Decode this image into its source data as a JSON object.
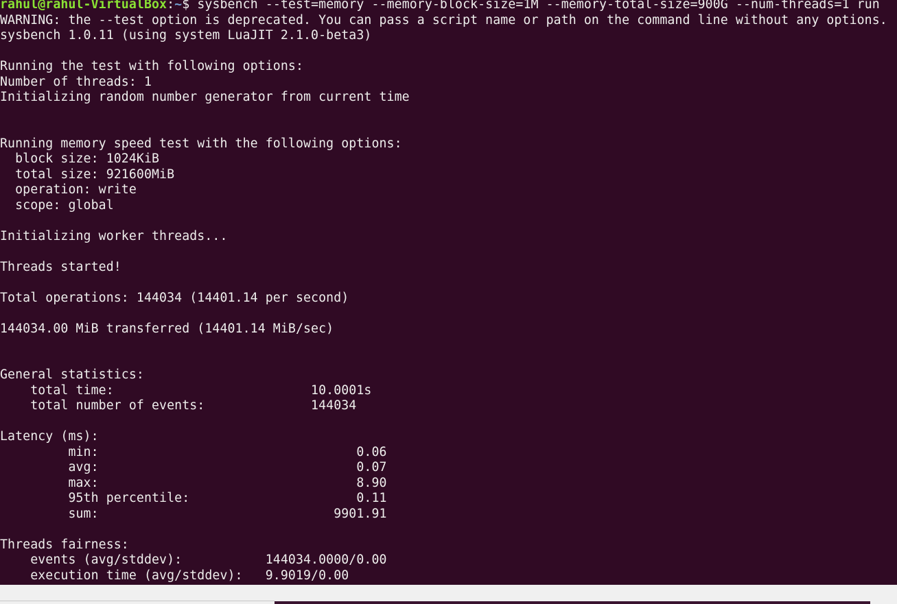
{
  "terminal": {
    "prompt": {
      "user_host": "rahul@rahul-VirtualBox",
      "separator": ":",
      "path": "~",
      "symbol": "$ ",
      "command": "sysbench --test=memory --memory-block-size=1M --memory-total-size=900G --num-threads=1 run"
    },
    "output_lines": [
      "WARNING: the --test option is deprecated. You can pass a script name or path on the command line without any options.",
      "sysbench 1.0.11 (using system LuaJIT 2.1.0-beta3)",
      "",
      "Running the test with following options:",
      "Number of threads: 1",
      "Initializing random number generator from current time",
      "",
      "",
      "Running memory speed test with the following options:",
      "  block size: 1024KiB",
      "  total size: 921600MiB",
      "  operation: write",
      "  scope: global",
      "",
      "Initializing worker threads...",
      "",
      "Threads started!",
      "",
      "Total operations: 144034 (14401.14 per second)",
      "",
      "144034.00 MiB transferred (14401.14 MiB/sec)",
      "",
      "",
      "General statistics:",
      "    total time:                          10.0001s",
      "    total number of events:              144034",
      "",
      "Latency (ms):",
      "         min:                                  0.06",
      "         avg:                                  0.07",
      "         max:                                  8.90",
      "         95th percentile:                      0.11",
      "         sum:                               9901.91",
      "",
      "Threads fairness:",
      "    events (avg/stddev):           144034.0000/0.00",
      "    execution time (avg/stddev):   9.9019/0.00"
    ]
  },
  "colors": {
    "background": "#300a24",
    "text": "#eeeeec",
    "user": "#8ae234",
    "path": "#729fcf"
  }
}
